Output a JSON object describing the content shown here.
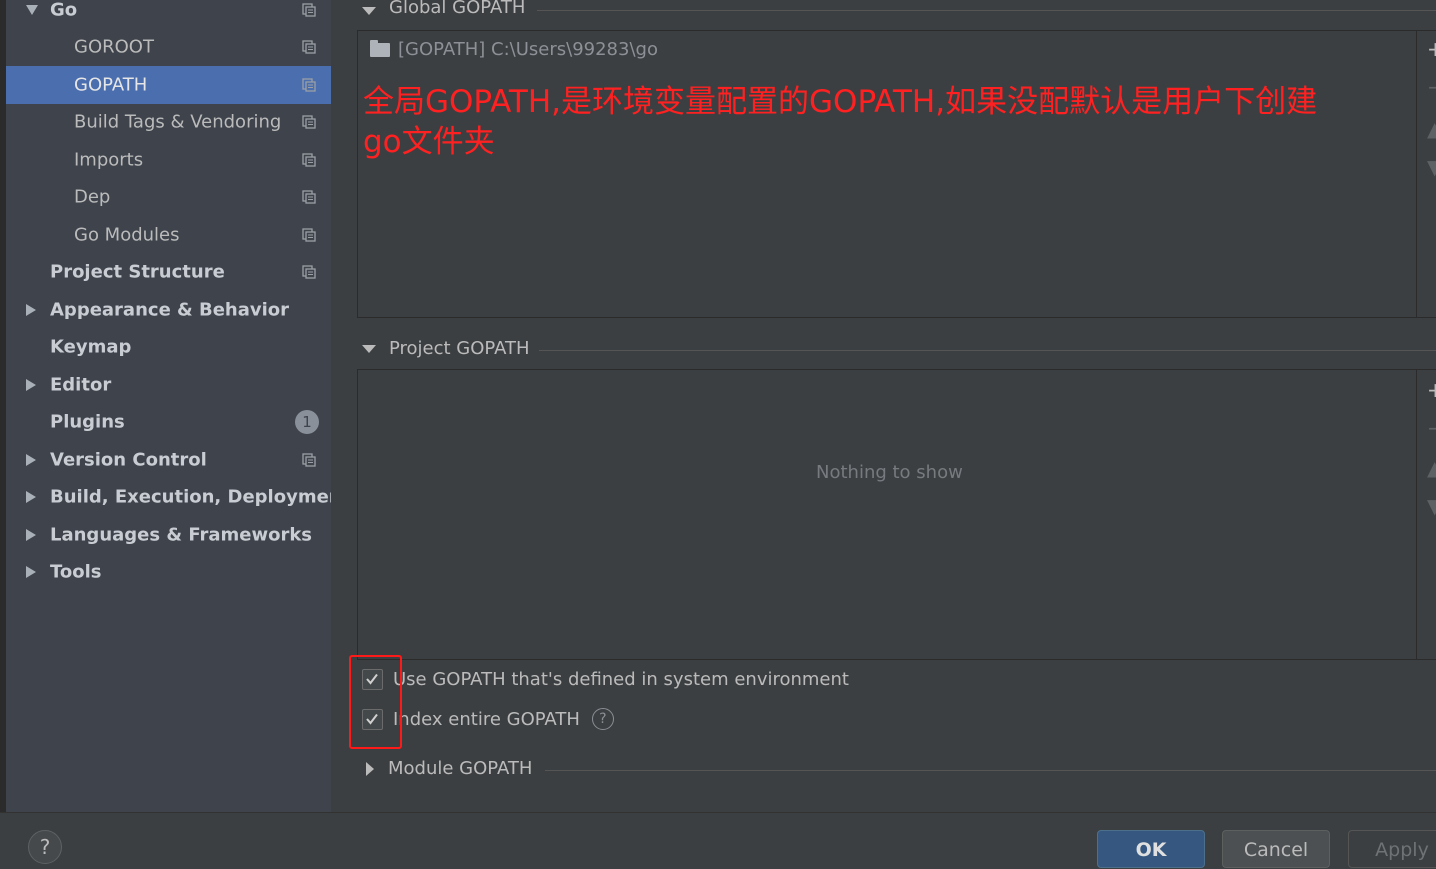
{
  "sidebar": {
    "items": [
      {
        "label": "Go",
        "bold": true,
        "arrow": "down",
        "copy": true
      },
      {
        "label": "GOROOT",
        "bold": false,
        "copy": true
      },
      {
        "label": "GOPATH",
        "bold": false,
        "copy": true,
        "selected": true
      },
      {
        "label": "Build Tags & Vendoring",
        "bold": false,
        "copy": true
      },
      {
        "label": "Imports",
        "bold": false,
        "copy": true
      },
      {
        "label": "Dep",
        "bold": false,
        "copy": true
      },
      {
        "label": "Go Modules",
        "bold": false,
        "copy": true
      },
      {
        "label": "Project Structure",
        "bold": true,
        "copy": true
      },
      {
        "label": "Appearance & Behavior",
        "bold": true,
        "arrow": "right"
      },
      {
        "label": "Keymap",
        "bold": true
      },
      {
        "label": "Editor",
        "bold": true,
        "arrow": "right"
      },
      {
        "label": "Plugins",
        "bold": true,
        "badge": "1"
      },
      {
        "label": "Version Control",
        "bold": true,
        "arrow": "right",
        "copy": true
      },
      {
        "label": "Build, Execution, Deployment",
        "bold": true,
        "arrow": "right"
      },
      {
        "label": "Languages & Frameworks",
        "bold": true,
        "arrow": "right"
      },
      {
        "label": "Tools",
        "bold": true,
        "arrow": "right"
      }
    ]
  },
  "global_gopath": {
    "title": "Global GOPATH",
    "entry": "[GOPATH] C:\\Users\\99283\\go"
  },
  "annotation": "全局GOPATH,是环境变量配置的GOPATH,如果没配默认是用户下创建go文件夹",
  "project_gopath": {
    "title": "Project GOPATH",
    "empty_text": "Nothing to show"
  },
  "options": {
    "use_system_gopath": {
      "label": "Use GOPATH that's defined in system environment",
      "checked": true
    },
    "index_entire_gopath": {
      "label": "Index entire GOPATH",
      "checked": true
    },
    "help_glyph": "?"
  },
  "module_gopath": {
    "title": "Module GOPATH"
  },
  "footer": {
    "help_glyph": "?",
    "ok_label": "OK",
    "cancel_label": "Cancel",
    "apply_label": "Apply"
  },
  "colors": {
    "selected": "#4b6eaf",
    "annotation": "#ff2121",
    "highlight": "#ff1a1a"
  }
}
